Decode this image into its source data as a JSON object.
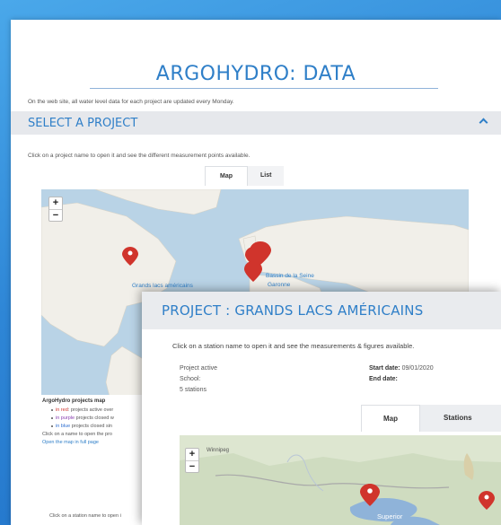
{
  "page": {
    "title": "ARGOHYDRO: DATA",
    "update_note": "On the web site, all water level data for each project are updated every Monday."
  },
  "select_section": {
    "title": "SELECT A PROJECT",
    "hint": "Click on a project name to open it and see the different measurement points available.",
    "tabs": [
      "Map",
      "List"
    ],
    "active_tab": "Map"
  },
  "world_map": {
    "zoom_in": "+",
    "zoom_out": "−",
    "labels": {
      "great_lakes": "Grands lacs américains",
      "seine_basin": "Bassin de la Seine",
      "garonne": "Garonne"
    },
    "legend": {
      "title": "ArgoHydro projects map",
      "items": [
        {
          "color_word": "in red",
          "rest": ": projects active over",
          "color": "#d0342c"
        },
        {
          "color_word": "in purple",
          "rest": " projects closed w",
          "color": "#8a3fb0"
        },
        {
          "color_word": "in blue",
          "rest": " projects closed sin",
          "color": "#2f6fd0"
        }
      ],
      "click_note": "Click on a name to open the pro",
      "full_page_link": "Open the map in full page"
    },
    "station_hint": "Click on a station name to open i"
  },
  "project_panel": {
    "title": "PROJECT : GRANDS LACS AMÉRICAINS",
    "station_note": "Click on a station name to open it and see the measurements & figures available.",
    "status": "Project active",
    "school_label": "School:",
    "stations_count": "5 stations",
    "start_date_label": "Start date:",
    "start_date_value": "09/01/2020",
    "end_date_label": "End date:",
    "tabs": [
      "Map",
      "Stations list"
    ],
    "active_tab": "Map",
    "map": {
      "zoom_in": "+",
      "zoom_out": "−",
      "city_label": "Winnipeg",
      "lake_label": "Superior"
    }
  },
  "colors": {
    "accent": "#2f7fc8",
    "marker_red": "#d0342c",
    "background_blue": "#2e86d6"
  }
}
